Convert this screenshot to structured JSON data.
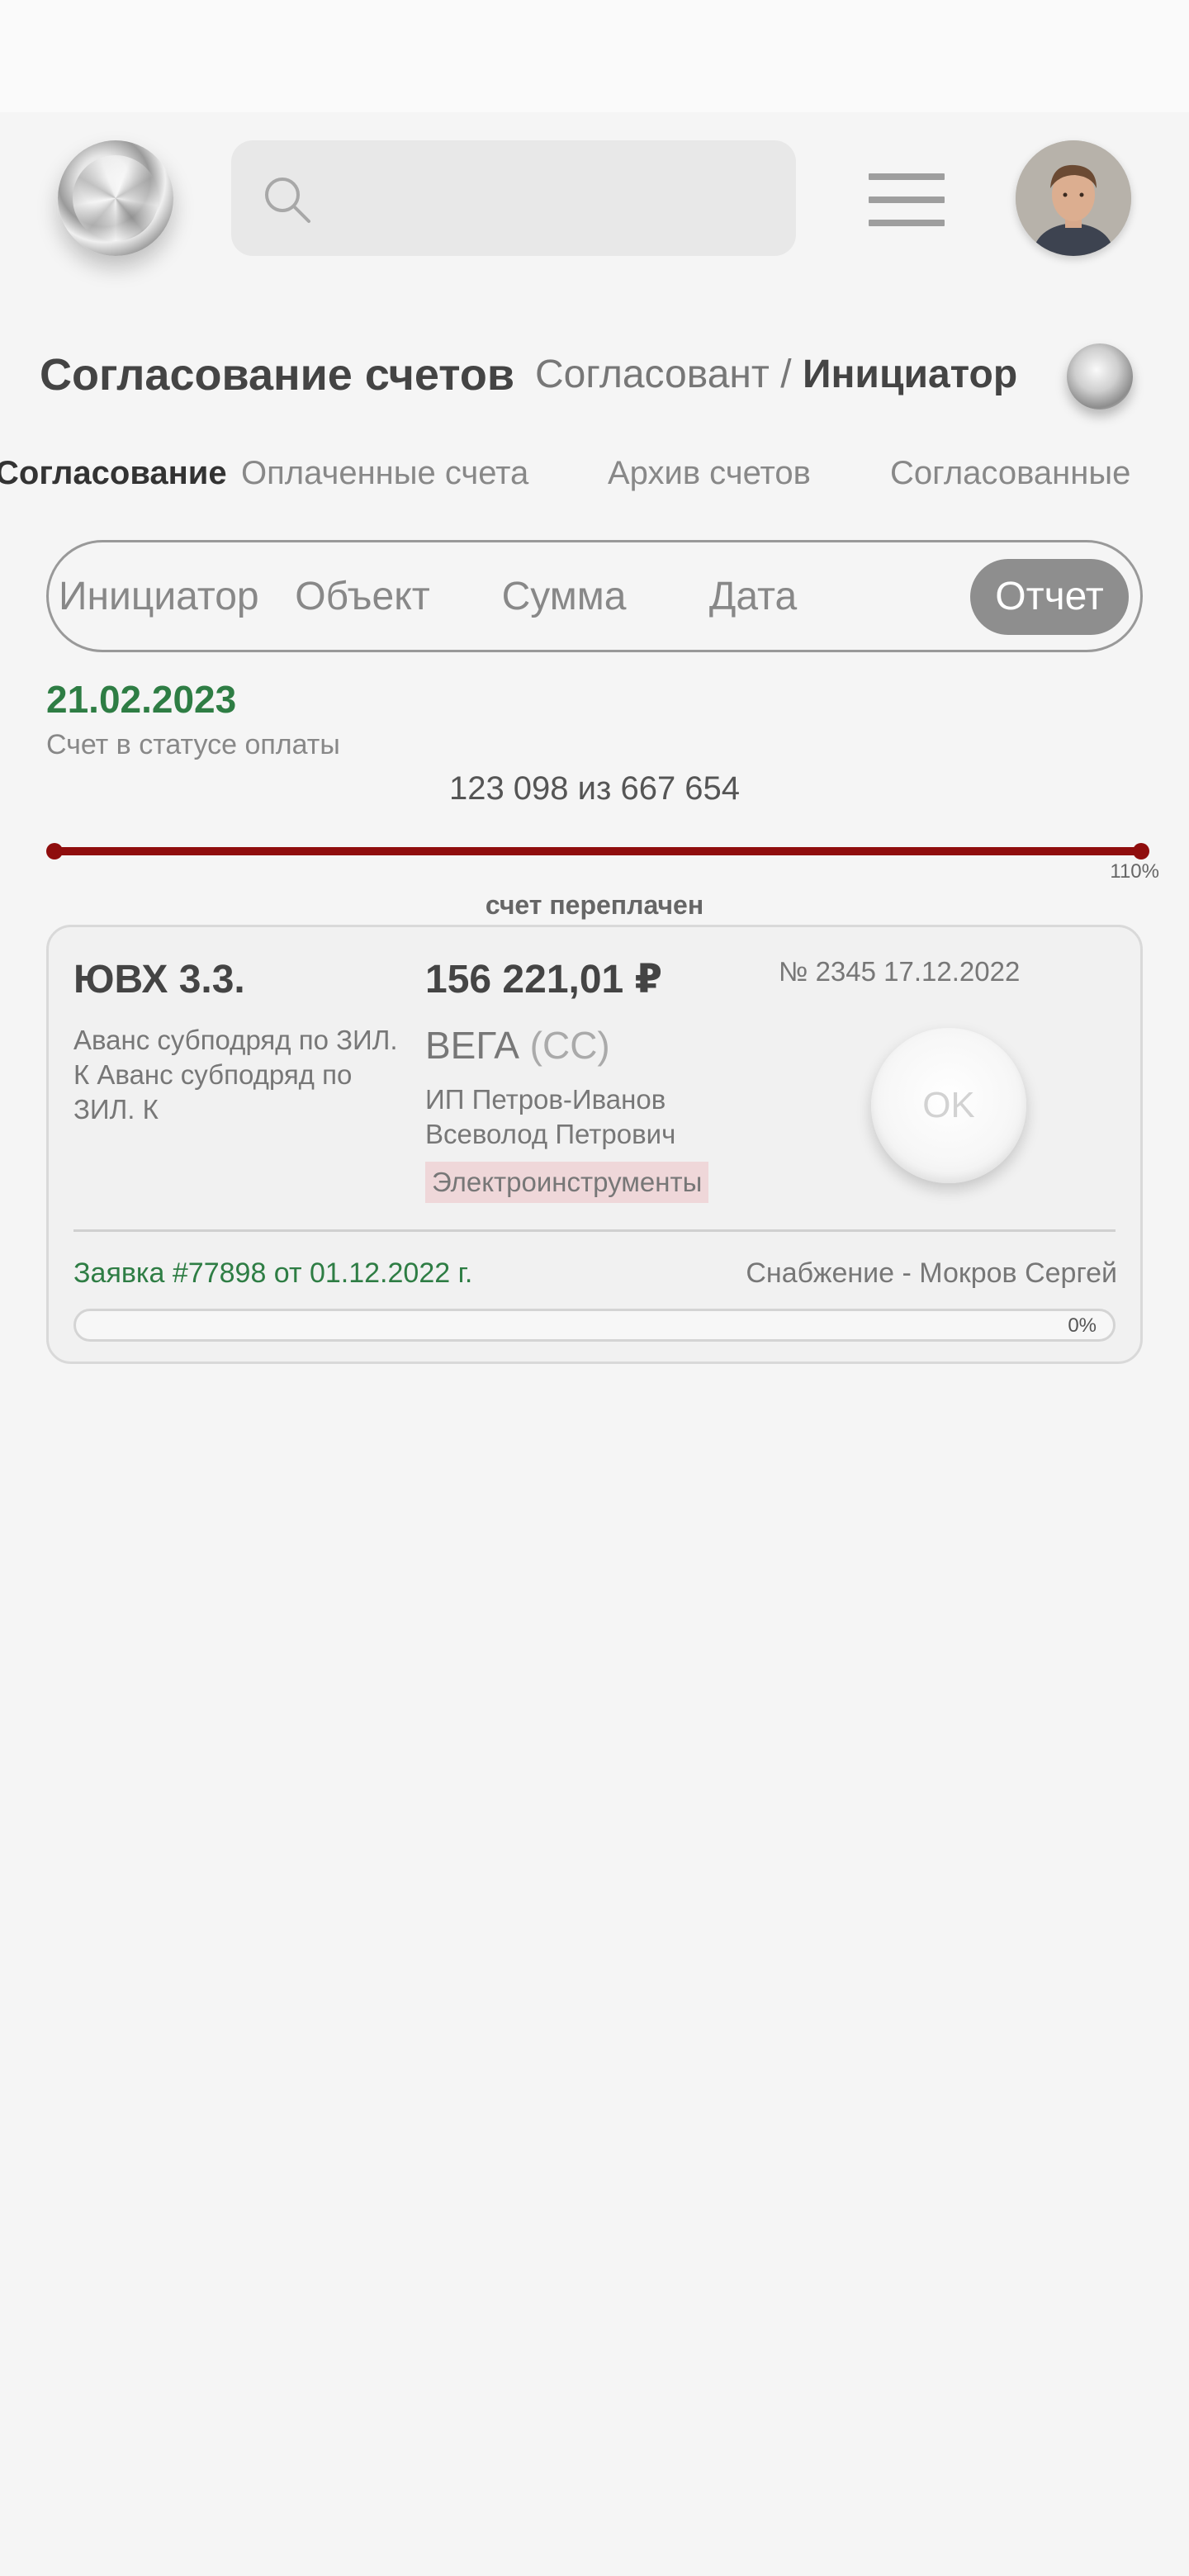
{
  "search": {
    "placeholder": ""
  },
  "page": {
    "title": "Согласование счетов",
    "role_inactive": "Согласовант",
    "role_separator": "/",
    "role_active": "Инициатор"
  },
  "tabs": [
    {
      "label": "Согласование",
      "active": true
    },
    {
      "label": "Оплаченные счета",
      "active": false
    },
    {
      "label": "Архив счетов",
      "active": false
    },
    {
      "label": "Согласованные",
      "active": false
    }
  ],
  "filters": [
    {
      "label": "Инициатор",
      "active": false
    },
    {
      "label": "Объект",
      "active": false
    },
    {
      "label": "Сумма",
      "active": false
    },
    {
      "label": "Дата",
      "active": false
    },
    {
      "label": "Отчет",
      "active": true
    }
  ],
  "summary": {
    "date": "21.02.2023",
    "status": "Счет в статусе оплаты",
    "progress_text": "123 098 из 667 654",
    "overpay_percent": "110%",
    "overpay_label": "счет переплачен"
  },
  "invoice": {
    "title": "ЮВХ 3.3.",
    "description": "Аванс субподряд по ЗИЛ. К Аванс субподряд по ЗИЛ. К",
    "amount": "156 221,01 ₽",
    "company": "ВЕГА",
    "company_suffix": "(СС)",
    "contact": "ИП Петров-Иванов Всеволод Петрович",
    "tag": "Электроинструменты",
    "number": "№ 2345 17.12.2022",
    "ok_label": "OK",
    "request": "Заявка #77898 от 01.12.2022 г.",
    "department": "Снабжение - Мокров Сергей",
    "progress_label": "0%",
    "progress_value": 0
  },
  "colors": {
    "accent_green": "#2e7d44",
    "overpay_red": "#8f0d0d",
    "tag_bg": "#efd7d9",
    "chip_active": "#8e8e8e"
  },
  "icons": [
    "logo-icon",
    "search-icon",
    "menu-icon",
    "avatar",
    "badge-icon"
  ]
}
